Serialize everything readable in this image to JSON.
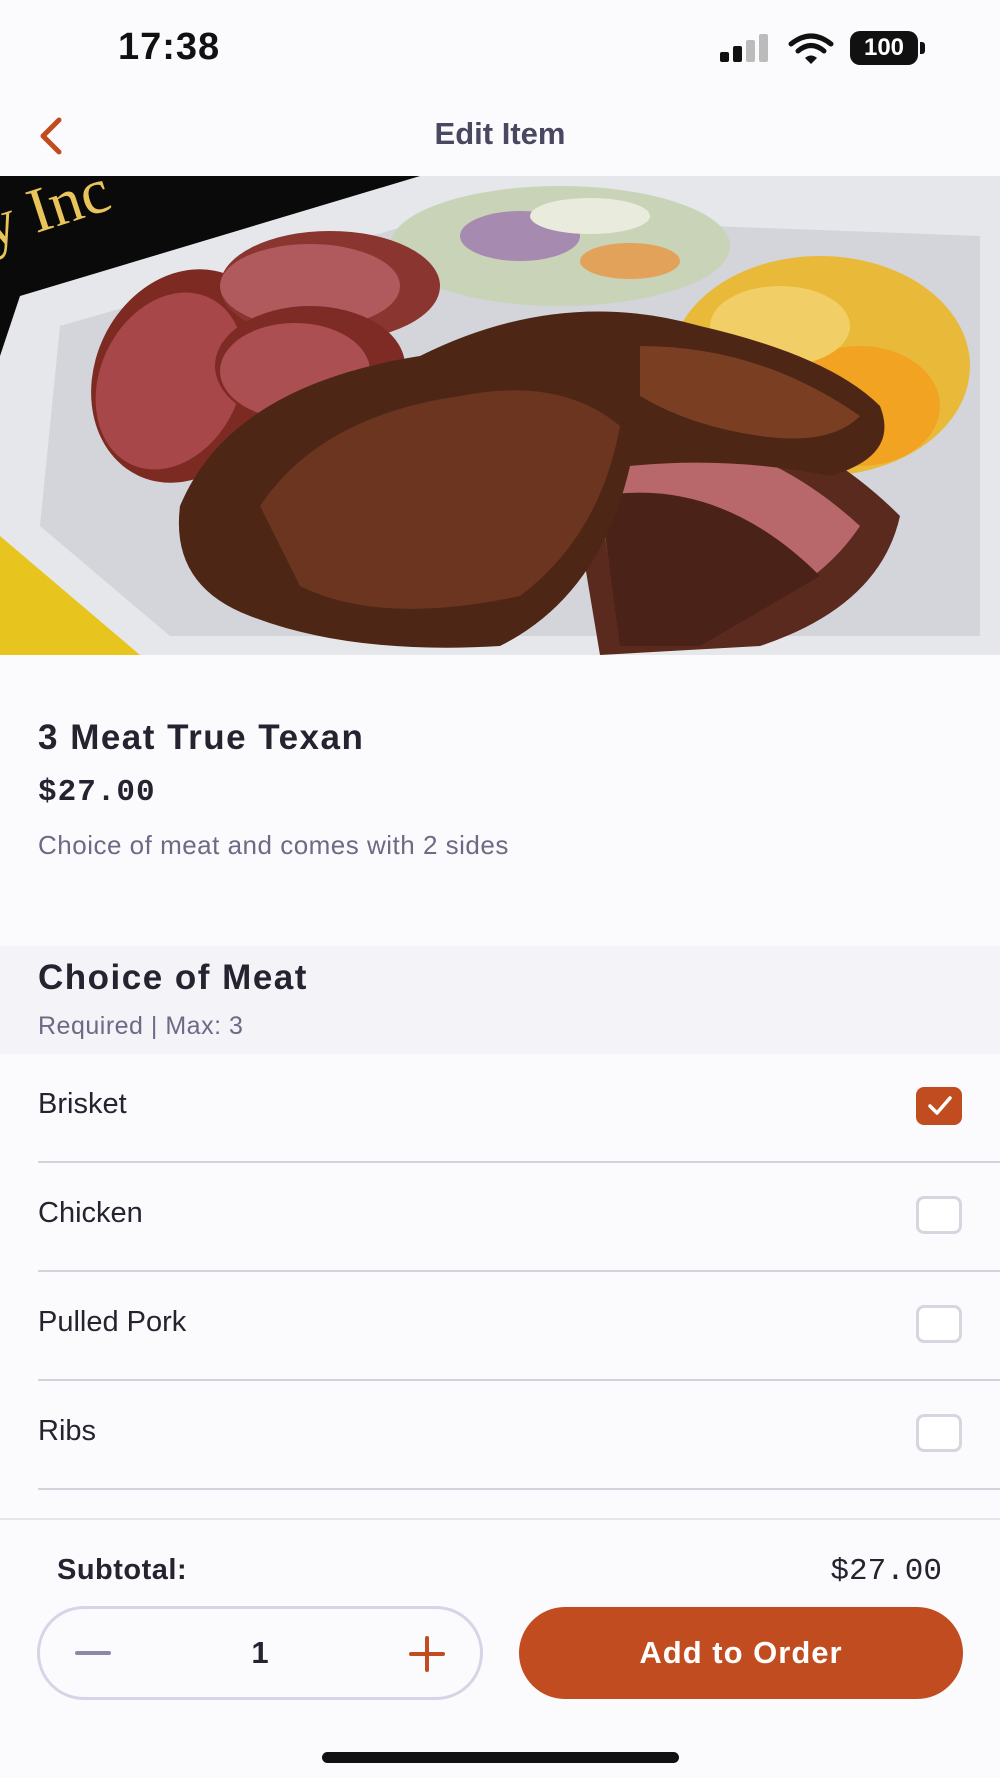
{
  "status_bar": {
    "time": "17:38",
    "battery": "100",
    "icons": [
      "cellular-signal-icon",
      "wifi-icon",
      "battery-icon"
    ]
  },
  "nav": {
    "title": "Edit Item",
    "back_icon": "chevron-left-icon"
  },
  "item": {
    "name": "3 Meat True Texan",
    "price": "$27.00",
    "description": "Choice of meat and comes with 2 sides"
  },
  "section": {
    "title": "Choice of Meat",
    "subtitle": "Required | Max: 3"
  },
  "options": [
    {
      "label": "Brisket",
      "checked": true
    },
    {
      "label": "Chicken",
      "checked": false
    },
    {
      "label": "Pulled Pork",
      "checked": false
    },
    {
      "label": "Ribs",
      "checked": false
    }
  ],
  "footer": {
    "subtotal_label": "Subtotal:",
    "subtotal_value": "$27.00",
    "quantity": "1",
    "add_label": "Add to Order"
  },
  "colors": {
    "accent": "#c14c1f",
    "text": "#25232f",
    "muted": "#6d6a86"
  }
}
